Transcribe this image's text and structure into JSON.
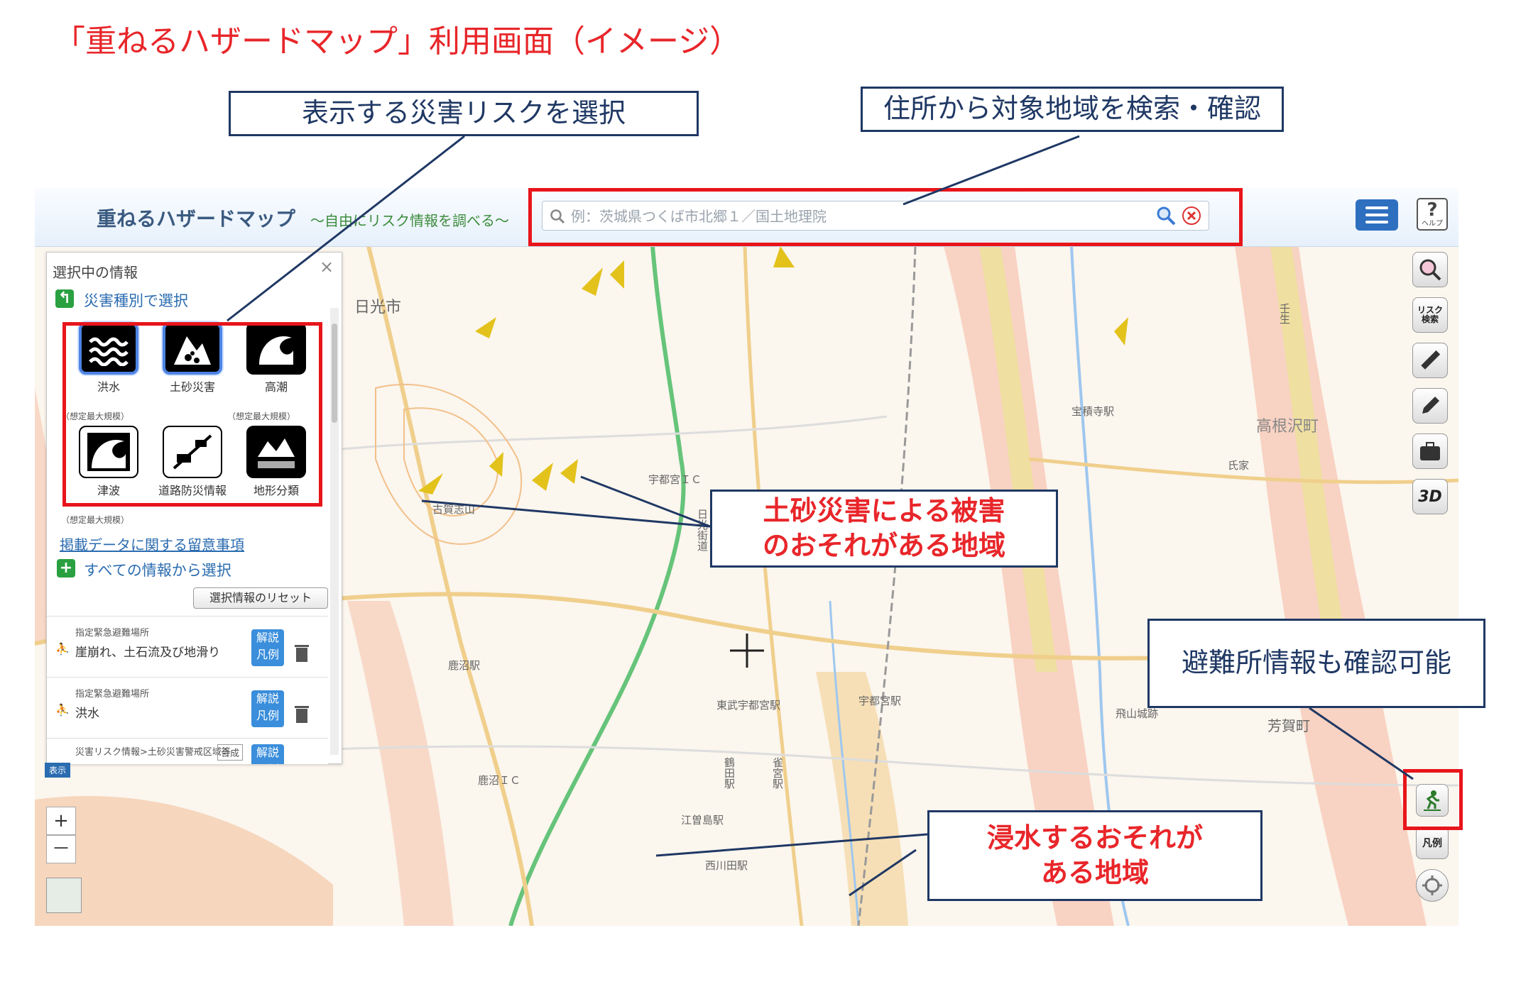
{
  "page_title": "「重ねるハザードマップ」利用画面（イメージ）",
  "callouts": {
    "hazard_select": "表示する災害リスクを選択",
    "address_search": "住所から対象地域を検索・確認",
    "landslide_area_line1": "土砂災害による被害",
    "landslide_area_line2": "のおそれがある地域",
    "shelter_info": "避難所情報も確認可能",
    "flood_area_line1": "浸水するおそれが",
    "flood_area_line2": "ある地域"
  },
  "app": {
    "title": "重ねるハザードマップ",
    "subtitle": "～自由にリスク情報を調べる～",
    "search_placeholder": "例：茨城県つくば市北郷１／国土地理院",
    "help_label": "?",
    "help_caption": "ヘルプ"
  },
  "panel": {
    "heading": "選択中の情報",
    "close": "×",
    "by_type_link": "災害種別で選択",
    "hazards": [
      {
        "label": "洪水",
        "note": "（想定最大規模）"
      },
      {
        "label": "土砂災害",
        "note": ""
      },
      {
        "label": "高潮",
        "note": "（想定最大規模）"
      },
      {
        "label": "津波",
        "note": "（想定最大規模）"
      },
      {
        "label": "道路防災情報",
        "note": ""
      },
      {
        "label": "地形分類",
        "note": ""
      }
    ],
    "data_notes_link": "掲載データに関する留意事項",
    "all_info_link": "すべての情報から選択",
    "reset_button": "選択情報のリセット",
    "layers": [
      {
        "category": "指定緊急避難場所",
        "name": "崖崩れ、土石流及び地滑り",
        "legend": "解説凡例"
      },
      {
        "category": "指定緊急避難場所",
        "name": "洪水",
        "legend": "解説凡例"
      },
      {
        "category": "災害リスク情報>土砂災害警戒区域等",
        "name": "",
        "legend": "解説凡例",
        "mode": "合成"
      }
    ],
    "display_tag": "表示"
  },
  "tools": {
    "risk_search": "リスク検索",
    "three_d": "3D",
    "legend": "凡例"
  },
  "zoom": {
    "in": "+",
    "out": "－"
  },
  "map_labels": [
    "日光市",
    "宇都宮ＩＣ",
    "日光街道",
    "古賀志山",
    "鹿沼駅",
    "鹿沼ＩＣ",
    "東武宇都宮駅",
    "宇都宮駅",
    "江曽島駅",
    "西川田駅",
    "鶴田駅",
    "雀宮駅",
    "壬生",
    "高根沢町",
    "宝積寺駅",
    "氏家",
    "飛山城跡",
    "芳賀町"
  ],
  "colors": {
    "title_red": "#e8262a",
    "callout_navy": "#1f3864",
    "frame_red": "#e8151b",
    "accent_blue": "#2e6fc0",
    "green": "#2aa041"
  }
}
